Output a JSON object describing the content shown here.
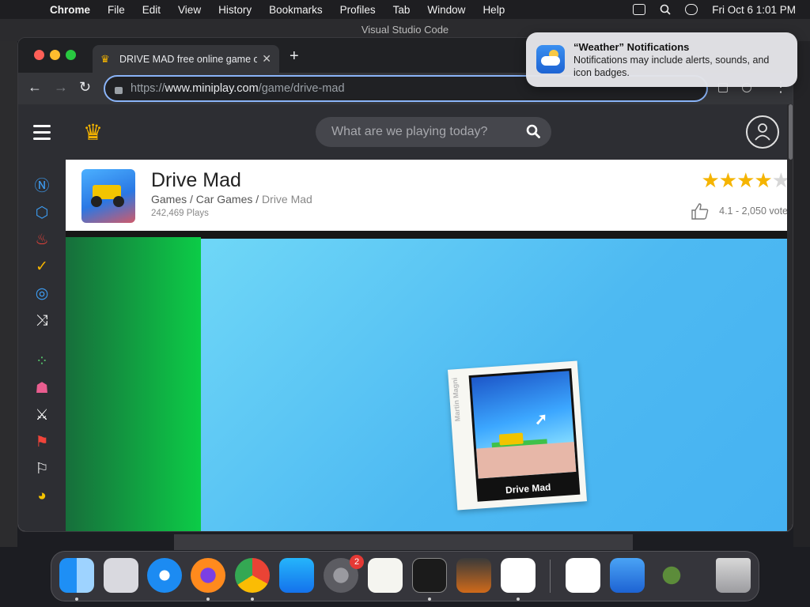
{
  "menubar": {
    "app_name": "Chrome",
    "items": [
      "File",
      "Edit",
      "View",
      "History",
      "Bookmarks",
      "Profiles",
      "Tab",
      "Window",
      "Help"
    ],
    "datetime": "Fri Oct 6  1:01 PM"
  },
  "background_window": {
    "title": "Visual Studio Code"
  },
  "browser": {
    "tab_title": "DRIVE MAD free online game on",
    "url_prefix": "https://",
    "url_host": "www.miniplay.com",
    "url_path": "/game/drive-mad"
  },
  "site": {
    "search_placeholder": "What are we playing today?",
    "side_icons": [
      "news-icon",
      "cube-icon",
      "fire-icon",
      "check-icon",
      "compass-icon",
      "shuffle-icon",
      "dots-icon",
      "multiplayer-icon",
      "swords-icon",
      "flag-icon",
      "checkered-flag-icon",
      "pacman-icon"
    ],
    "game": {
      "title": "Drive Mad",
      "breadcrumb_games": "Games",
      "breadcrumb_category": "Car Games",
      "breadcrumb_current": "Drive Mad",
      "breadcrumb_sep": " / ",
      "plays": "242,469 Plays",
      "rating_text": "4.1 - 2,050 vote",
      "stars_filled": 4,
      "stars_total": 5,
      "card_caption": "Drive Mad",
      "card_author": "Martin Magni"
    }
  },
  "notification": {
    "title": "“Weather” Notifications",
    "body": "Notifications may include alerts, sounds, and icon badges."
  },
  "dock": {
    "apps": [
      "finder-icon",
      "launchpad-icon",
      "safari-icon",
      "firefox-icon",
      "chrome-icon",
      "app-store-icon",
      "system-settings-icon",
      "textedit-icon",
      "terminal-icon",
      "garageband-icon",
      "vscode-icon",
      "visual-studio-icon",
      "weather-icon",
      "downloads-icon",
      "trash-icon"
    ],
    "settings_badge": "2"
  },
  "colors": {
    "accent": "#8ab4f8",
    "star": "#f5b400",
    "site_dark": "#2d2e33",
    "game_green": "#0ccc47",
    "game_blue": "#4db9f2"
  }
}
